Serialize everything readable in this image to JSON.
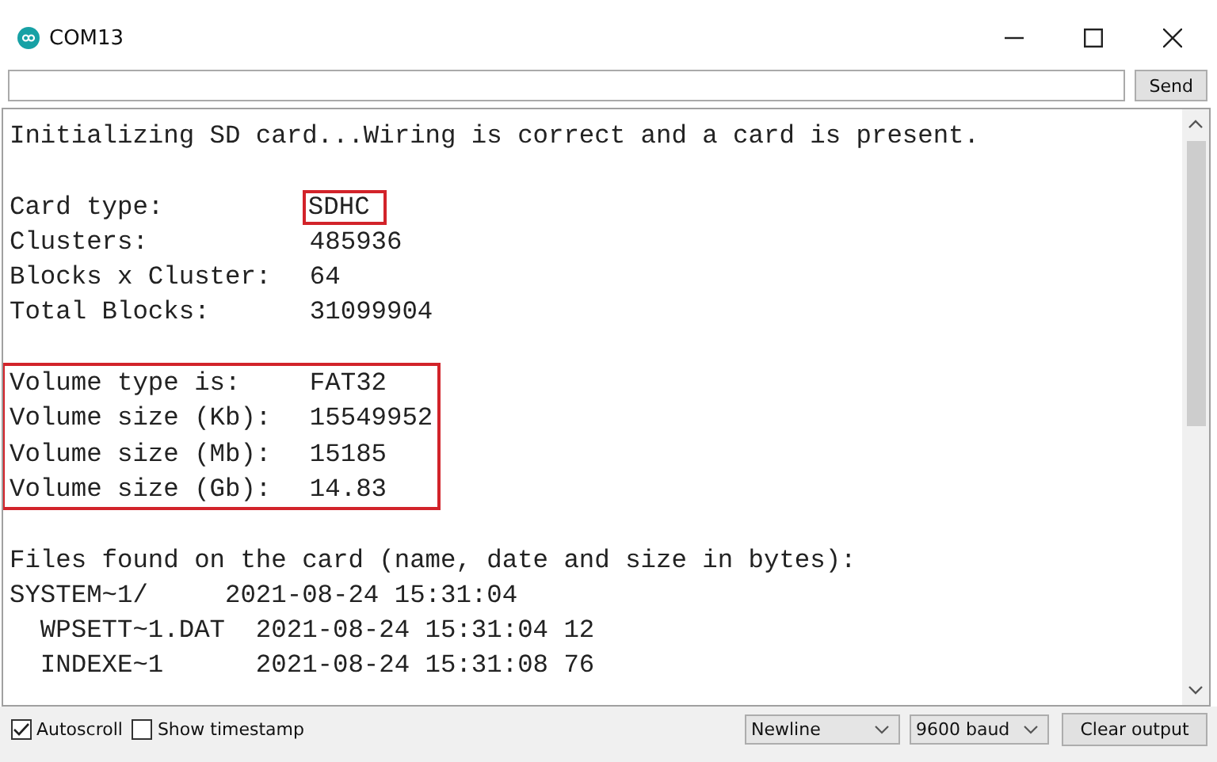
{
  "window": {
    "title": "COM13"
  },
  "send_button": "Send",
  "output": {
    "lines_before": [
      {
        "kind": "text",
        "text": "Initializing SD card...Wiring is correct and a card is present."
      },
      {
        "kind": "blank"
      },
      {
        "kind": "field",
        "label": "Card type:",
        "value": "SDHC",
        "value_highlighted": true
      },
      {
        "kind": "field",
        "label": "Clusters:",
        "value": "485936",
        "value_highlighted": false
      },
      {
        "kind": "field",
        "label": "Blocks x Cluster:",
        "value": "64",
        "value_highlighted": false
      },
      {
        "kind": "field",
        "label": "Total Blocks:",
        "value": "31099904",
        "value_highlighted": false
      },
      {
        "kind": "blank"
      }
    ],
    "framed_lines": [
      {
        "kind": "field",
        "label": "Volume type is:",
        "value": "FAT32",
        "value_highlighted": false
      },
      {
        "kind": "field",
        "label": "Volume size (Kb):",
        "value": "15549952",
        "value_highlighted": false
      },
      {
        "kind": "field",
        "label": "Volume size (Mb):",
        "value": "15185",
        "value_highlighted": false
      },
      {
        "kind": "field",
        "label": "Volume size (Gb):",
        "value": "14.83",
        "value_highlighted": false
      }
    ],
    "lines_after": [
      {
        "kind": "blank"
      },
      {
        "kind": "text",
        "text": "Files found on the card (name, date and size in bytes):"
      },
      {
        "kind": "text",
        "text": "SYSTEM~1/     2021-08-24 15:31:04"
      },
      {
        "kind": "text",
        "text": "  WPSETT~1.DAT  2021-08-24 15:31:04 12"
      },
      {
        "kind": "text",
        "text": "  INDEXE~1      2021-08-24 15:31:08 76"
      }
    ]
  },
  "autoscroll": {
    "label": "Autoscroll",
    "checked": true
  },
  "show_timestamp": {
    "label": "Show timestamp",
    "checked": false
  },
  "line_ending": "Newline",
  "baud_rate": "9600 baud",
  "clear_button": "Clear output"
}
